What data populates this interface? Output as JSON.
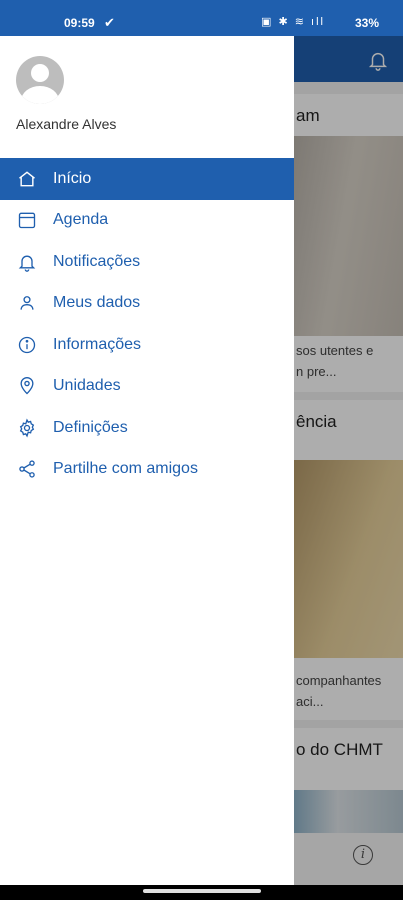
{
  "status_bar": {
    "time": "09:59",
    "check": "✔",
    "sys_icons": "▣ ✱ ≋ ıll",
    "battery": "33%"
  },
  "user": {
    "name": "Alexandre Alves"
  },
  "menu": {
    "items": [
      {
        "label": "Início",
        "icon": "home-icon",
        "active": true
      },
      {
        "label": "Agenda",
        "icon": "calendar-icon"
      },
      {
        "label": "Notificações",
        "icon": "bell-icon"
      },
      {
        "label": "Meus dados",
        "icon": "person-icon"
      },
      {
        "label": "Informações",
        "icon": "info-icon"
      },
      {
        "label": "Unidades",
        "icon": "location-pin-icon"
      },
      {
        "label": "Definições",
        "icon": "gear-icon"
      },
      {
        "label": "Partilhe com amigos",
        "icon": "share-icon"
      }
    ]
  },
  "background": {
    "cards": [
      {
        "title": "am",
        "text_line1": "sos utentes e",
        "text_line2": "n pre..."
      },
      {
        "title": "ência",
        "text_line1": "companhantes",
        "text_line2": "aci..."
      },
      {
        "title": "o do CHMT"
      }
    ],
    "info_glyph": "i"
  },
  "colors": {
    "primary": "#1f5fae",
    "drawer_bg": "#ffffff",
    "active_text": "#ffffff"
  }
}
